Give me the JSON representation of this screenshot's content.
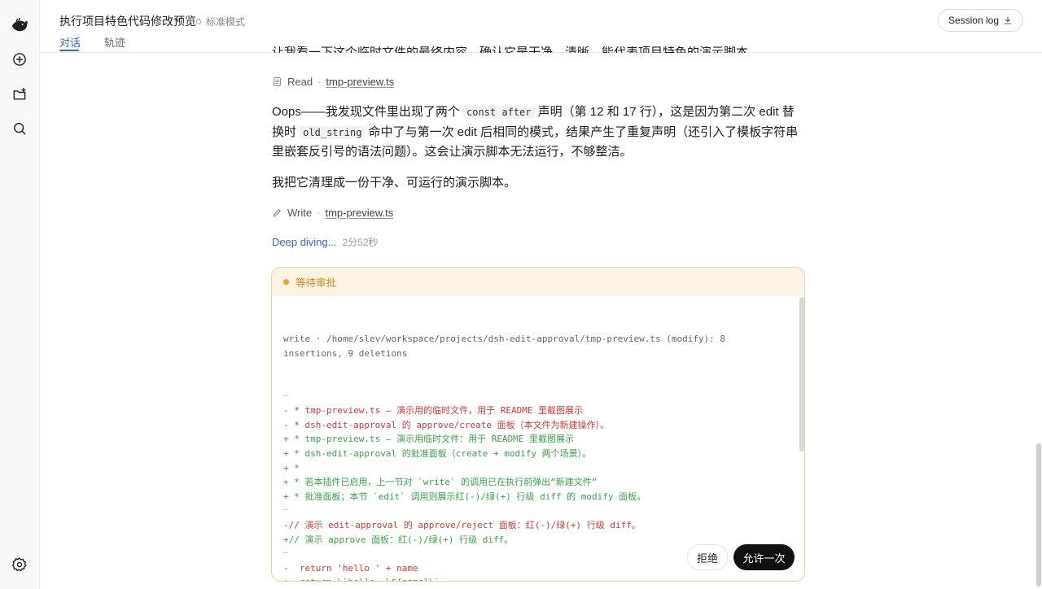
{
  "app": {
    "title": "执行项目特色代码修改预览",
    "mode": "标准模式",
    "session_log": "Session log"
  },
  "tabs": [
    {
      "label": "对话",
      "active": true
    },
    {
      "label": "轨迹",
      "active": false
    }
  ],
  "rail": {
    "items": [
      "logo-icon",
      "new-chat-icon",
      "add-project-icon",
      "search-icon"
    ],
    "bottom": "settings-icon"
  },
  "conversation": {
    "clipped_text": "让我看一下这个临时文件的最终内容，确认它是干净、清晰、能代表项目特色的演示脚本。",
    "read_tool": {
      "label": "Read",
      "file": "tmp-preview.ts"
    },
    "para1": {
      "a": "Oops——我发现文件里出现了两个 ",
      "code1": "const after",
      "b": " 声明（第 12 和 17 行），这是因为第二次 edit 替换时 ",
      "code2": "old_string",
      "c": " 命中了与第一次 edit 后相同的模式，结果产生了重复声明（还引入了模板字符串里嵌套反引号的语法问题）。这会让演示脚本无法运行，不够整洁。"
    },
    "para2": "我把它清理成一份干净、可运行的演示脚本。",
    "write_tool": {
      "label": "Write",
      "file": "tmp-preview.ts"
    },
    "deep_diving": {
      "label": "Deep diving...",
      "time": "2分52秒"
    }
  },
  "approval": {
    "status": "等待审批",
    "meta": "write · /home/slev/workspace/projects/dsh-edit-approval/tmp-preview.ts (modify): 8 insertions, 9 deletions",
    "lines": [
      {
        "t": "sep",
        "text": "⋯"
      },
      {
        "t": "del",
        "text": "- * tmp-preview.ts — 演示用的临时文件，用于 README 里截图展示"
      },
      {
        "t": "del",
        "text": "- * dsh-edit-approval 的 approve/create 面板（本文件为新建操作）。"
      },
      {
        "t": "add",
        "text": "+ * tmp-preview.ts — 演示用临时文件：用于 README 里截图展示"
      },
      {
        "t": "add",
        "text": "+ * dsh-edit-approval 的批准面板（create + modify 两个场景）。"
      },
      {
        "t": "add",
        "text": "+ *"
      },
      {
        "t": "add",
        "text": "+ * 若本插件已启用，上一节对 `write` 的调用已在执行前弹出“新建文件”"
      },
      {
        "t": "add",
        "text": "+ * 批准面板；本节 `edit` 调用则展示红(-)/绿(+) 行级 diff 的 modify 面板。"
      },
      {
        "t": "sep",
        "text": "⋯"
      },
      {
        "t": "del",
        "text": "-// 演示 edit-approval 的 approve/reject 面板：红(-)/绿(+) 行级 diff。"
      },
      {
        "t": "add",
        "text": "+// 演示 approve 面板：红(-)/绿(+) 行级 diff。"
      },
      {
        "t": "sep",
        "text": "⋯"
      },
      {
        "t": "del",
        "text": "-  return 'hello ' + name"
      },
      {
        "t": "add",
        "text": "+  return \\`hello, \\${name}\\`"
      }
    ],
    "reject": "拒绝",
    "allow_once": "允许一次"
  }
}
